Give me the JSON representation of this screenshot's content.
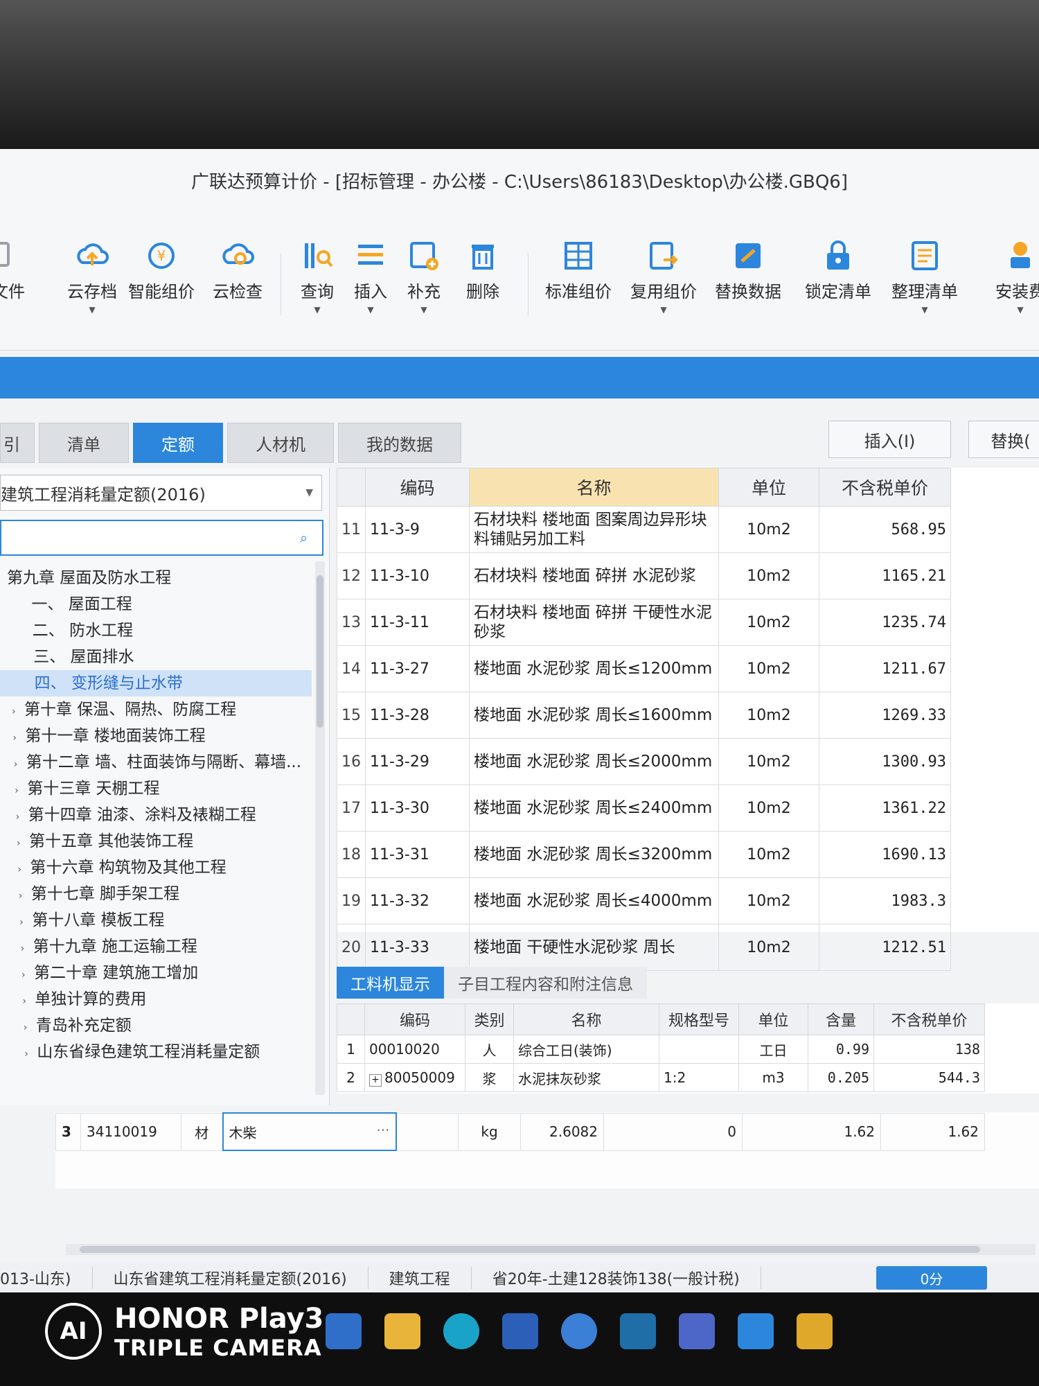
{
  "window": {
    "title": "广联达预算计价 - [招标管理 - 办公楼 - C:\\Users\\86183\\Desktop\\办公楼.GBQ6]"
  },
  "toolbar": {
    "items": [
      {
        "label": "换文件",
        "icon": "file-swap-icon"
      },
      {
        "label": "云存档",
        "icon": "cloud-upload-icon",
        "has_dropdown": true
      },
      {
        "label": "智能组价",
        "icon": "smart-pricing-icon"
      },
      {
        "label": "云检查",
        "icon": "cloud-check-icon"
      },
      {
        "label": "查询",
        "icon": "query-icon",
        "has_dropdown": true
      },
      {
        "label": "插入",
        "icon": "insert-icon",
        "has_dropdown": true
      },
      {
        "label": "补充",
        "icon": "supplement-icon",
        "has_dropdown": true
      },
      {
        "label": "删除",
        "icon": "trash-icon"
      },
      {
        "label": "标准组价",
        "icon": "standard-pricing-icon"
      },
      {
        "label": "复用组价",
        "icon": "reuse-pricing-icon",
        "has_dropdown": true
      },
      {
        "label": "替换数据",
        "icon": "replace-data-icon"
      },
      {
        "label": "锁定清单",
        "icon": "lock-icon"
      },
      {
        "label": "整理清单",
        "icon": "organize-list-icon",
        "has_dropdown": true
      },
      {
        "label": "安装费",
        "icon": "install-fee-icon",
        "has_dropdown": true
      }
    ],
    "colors": {
      "icon_blue": "#2c86dc",
      "icon_orange": "#f5a623"
    }
  },
  "tabs": [
    {
      "label": "引",
      "active": false
    },
    {
      "label": "清单",
      "active": false
    },
    {
      "label": "定额",
      "active": true
    },
    {
      "label": "人材机",
      "active": false
    },
    {
      "label": "我的数据",
      "active": false
    }
  ],
  "actions": {
    "insert": "插入(I)",
    "replace": "替换("
  },
  "left": {
    "library_select": "建筑工程消耗量定额(2016)",
    "search_placeholder": "",
    "tree": [
      {
        "label": "第九章 屋面及防水工程",
        "level": 0,
        "selected": false
      },
      {
        "label": "一、 屋面工程",
        "level": 1,
        "selected": false
      },
      {
        "label": "二、 防水工程",
        "level": 1,
        "selected": false
      },
      {
        "label": "三、 屋面排水",
        "level": 1,
        "selected": false
      },
      {
        "label": "四、 变形缝与止水带",
        "level": 1,
        "selected": true
      },
      {
        "label": "第十章 保温、隔热、防腐工程",
        "level": 0,
        "selected": false
      },
      {
        "label": "第十一章 楼地面装饰工程",
        "level": 0,
        "selected": false
      },
      {
        "label": "第十二章 墙、柱面装饰与隔断、幕墙...",
        "level": 0,
        "selected": false
      },
      {
        "label": "第十三章 天棚工程",
        "level": 0,
        "selected": false
      },
      {
        "label": "第十四章 油漆、涂料及裱糊工程",
        "level": 0,
        "selected": false
      },
      {
        "label": "第十五章 其他装饰工程",
        "level": 0,
        "selected": false
      },
      {
        "label": "第十六章 构筑物及其他工程",
        "level": 0,
        "selected": false
      },
      {
        "label": "第十七章 脚手架工程",
        "level": 0,
        "selected": false
      },
      {
        "label": "第十八章 模板工程",
        "level": 0,
        "selected": false
      },
      {
        "label": "第十九章 施工运输工程",
        "level": 0,
        "selected": false
      },
      {
        "label": "第二十章 建筑施工增加",
        "level": 0,
        "selected": false
      },
      {
        "label": "单独计算的费用",
        "level": 0,
        "selected": false
      },
      {
        "label": "青岛补充定额",
        "level": 0,
        "selected": false
      },
      {
        "label": "山东省绿色建筑工程消耗量定额",
        "level": 0,
        "selected": false
      }
    ]
  },
  "main_table": {
    "headers": {
      "code": "编码",
      "name": "名称",
      "unit": "单位",
      "price": "不含税单价"
    },
    "rows": [
      {
        "no": "11",
        "code": "11-3-9",
        "name": "石材块料 楼地面 图案周边异形块料铺贴另加工料",
        "unit": "10m2",
        "price": "568.95"
      },
      {
        "no": "12",
        "code": "11-3-10",
        "name": "石材块料 楼地面 碎拼 水泥砂浆",
        "unit": "10m2",
        "price": "1165.21"
      },
      {
        "no": "13",
        "code": "11-3-11",
        "name": "石材块料 楼地面 碎拼 干硬性水泥砂浆",
        "unit": "10m2",
        "price": "1235.74"
      },
      {
        "no": "14",
        "code": "11-3-27",
        "name": "楼地面 水泥砂浆 周长≤1200mm",
        "unit": "10m2",
        "price": "1211.67"
      },
      {
        "no": "15",
        "code": "11-3-28",
        "name": "楼地面 水泥砂浆 周长≤1600mm",
        "unit": "10m2",
        "price": "1269.33"
      },
      {
        "no": "16",
        "code": "11-3-29",
        "name": "楼地面 水泥砂浆 周长≤2000mm",
        "unit": "10m2",
        "price": "1300.93"
      },
      {
        "no": "17",
        "code": "11-3-30",
        "name": "楼地面 水泥砂浆 周长≤2400mm",
        "unit": "10m2",
        "price": "1361.22"
      },
      {
        "no": "18",
        "code": "11-3-31",
        "name": "楼地面 水泥砂浆 周长≤3200mm",
        "unit": "10m2",
        "price": "1690.13"
      },
      {
        "no": "19",
        "code": "11-3-32",
        "name": "楼地面 水泥砂浆 周长≤4000mm",
        "unit": "10m2",
        "price": "1983.3"
      },
      {
        "no": "20",
        "code": "11-3-33",
        "name": "楼地面 干硬性水泥砂浆 周长",
        "unit": "10m2",
        "price": "1212.51"
      }
    ]
  },
  "lower_tabs": [
    {
      "label": "工料机显示",
      "active": true
    },
    {
      "label": "子目工程内容和附注信息",
      "active": false
    }
  ],
  "sub_table": {
    "headers": {
      "code": "编码",
      "type": "类别",
      "name": "名称",
      "spec": "规格型号",
      "unit": "单位",
      "qty": "含量",
      "price": "不含税单价"
    },
    "rows": [
      {
        "no": "1",
        "code": "00010020",
        "type": "人",
        "name": "综合工日(装饰)",
        "spec": "",
        "unit": "工日",
        "qty": "0.99",
        "price": "138",
        "expand": ""
      },
      {
        "no": "2",
        "code": "80050009",
        "type": "浆",
        "name": "水泥抹灰砂浆",
        "spec": "1:2",
        "unit": "m3",
        "qty": "0.205",
        "price": "544.3",
        "expand": "+"
      }
    ]
  },
  "bottom_row": {
    "no": "3",
    "code": "34110019",
    "type": "材",
    "name": "木柴",
    "unit": "kg",
    "qty": "2.6082",
    "v1": "0",
    "v2": "1.62",
    "v3": "1.62"
  },
  "status": {
    "items": [
      "013-山东)",
      "山东省建筑工程消耗量定额(2016)",
      "建筑工程",
      "省20年-土建128装饰138(一般计税)"
    ],
    "button": "0分"
  },
  "watermark": {
    "line1": "HONOR Play3",
    "line2": "TRIPLE CAMERA",
    "logo": "AI"
  }
}
